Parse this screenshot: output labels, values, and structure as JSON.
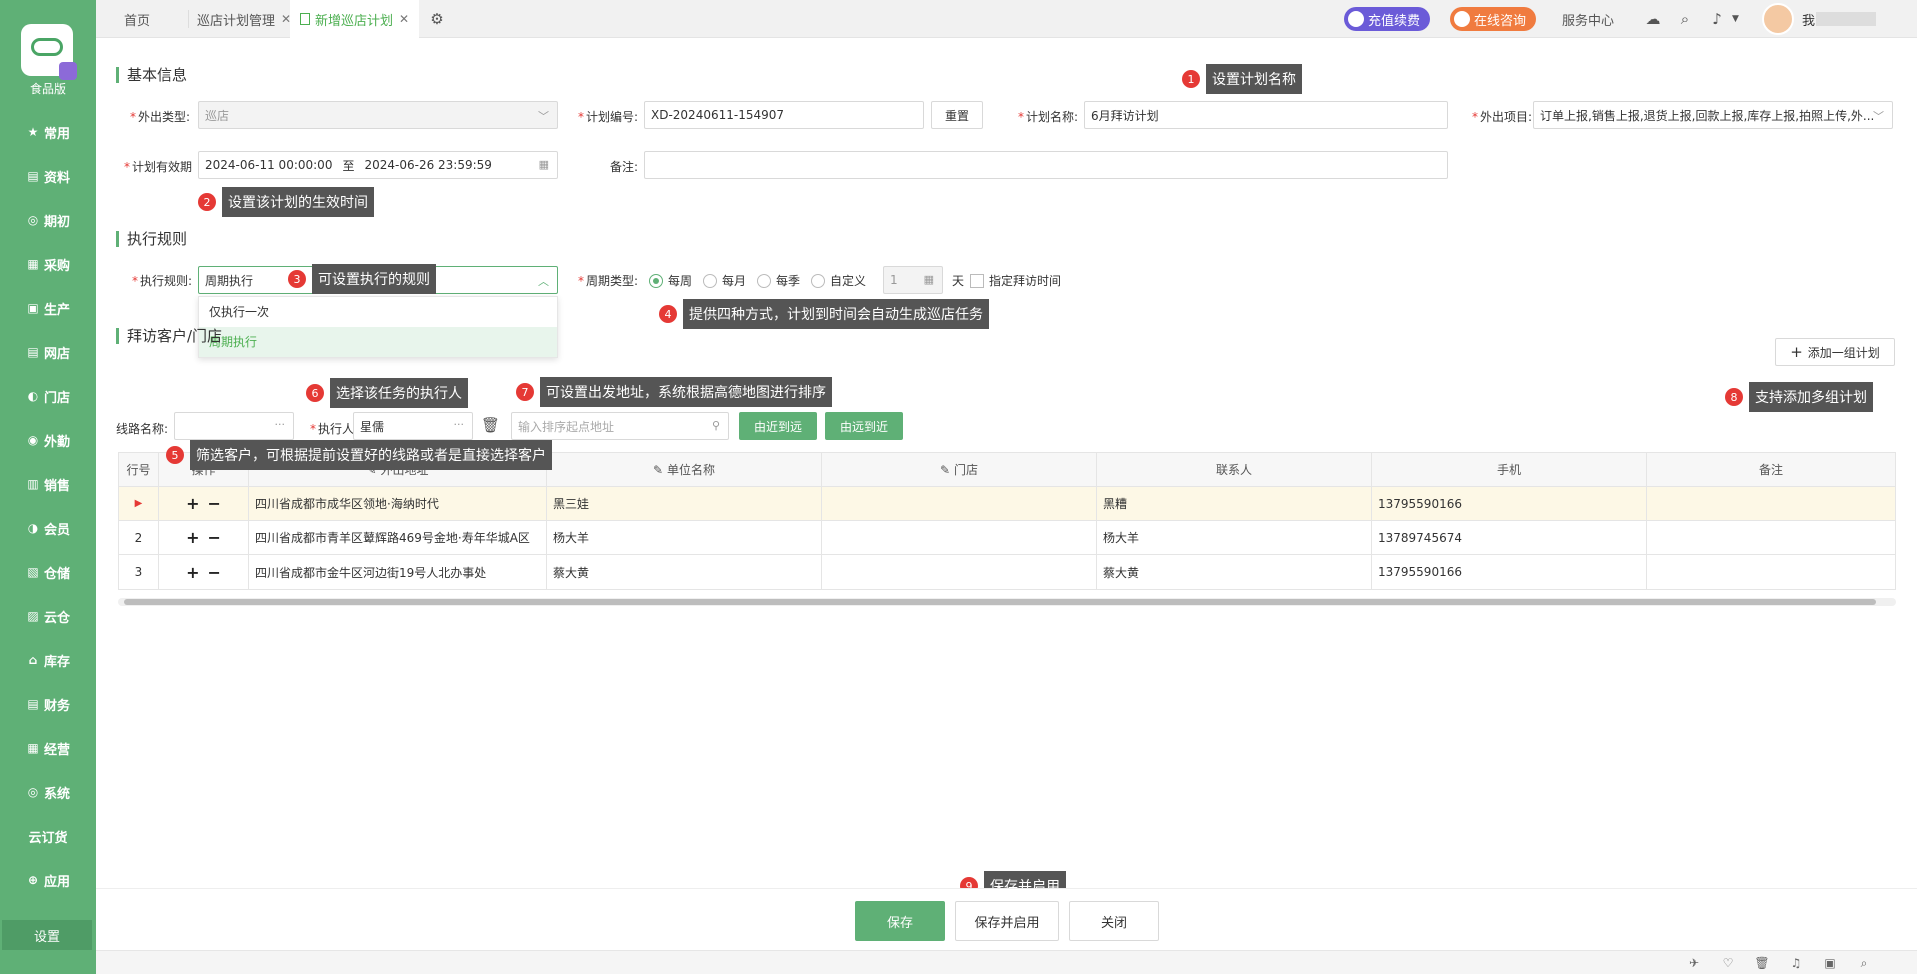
{
  "sidebar": {
    "logo_name": "食品版",
    "items": [
      {
        "label": "常用",
        "icon": "★"
      },
      {
        "label": "资料",
        "icon": "▤"
      },
      {
        "label": "期初",
        "icon": "◎"
      },
      {
        "label": "采购",
        "icon": "▦"
      },
      {
        "label": "生产",
        "icon": "▣"
      },
      {
        "label": "网店",
        "icon": "▤"
      },
      {
        "label": "门店",
        "icon": "◐"
      },
      {
        "label": "外勤",
        "icon": "◉"
      },
      {
        "label": "销售",
        "icon": "▥"
      },
      {
        "label": "会员",
        "icon": "◑"
      },
      {
        "label": "仓储",
        "icon": "▧"
      },
      {
        "label": "云仓",
        "icon": "▨"
      },
      {
        "label": "库存",
        "icon": "⌂"
      },
      {
        "label": "财务",
        "icon": "▤"
      },
      {
        "label": "经营",
        "icon": "▦"
      },
      {
        "label": "系统",
        "icon": "◎"
      },
      {
        "label": "云订货",
        "icon": ""
      },
      {
        "label": "应用",
        "icon": "⊕"
      }
    ],
    "settings": "设置"
  },
  "tabs": [
    {
      "label": "首页"
    },
    {
      "label": "巡店计划管理",
      "close": "✕"
    },
    {
      "label": "新增巡店计划",
      "close": "✕"
    }
  ],
  "topbar": {
    "recharge": "充值续费",
    "consult": "在线咨询",
    "service": "服务中心",
    "user_initial": "我"
  },
  "sections": {
    "basic": "基本信息",
    "rules": "执行规则",
    "visit": "拜访客户/门店"
  },
  "form": {
    "out_type_label": "外出类型:",
    "out_type_value": "巡店",
    "plan_no_label": "计划编号:",
    "plan_no_value": "XD-20240611-154907",
    "reset_btn": "重置",
    "plan_name_label": "计划名称:",
    "plan_name_value": "6月拜访计划",
    "out_items_label": "外出项目:",
    "out_items_value": "订单上报,销售上报,退货上报,回款上报,库存上报,拍照上传,外...",
    "valid_label": "计划有效期",
    "valid_start": "2024-06-11 00:00:00",
    "valid_sep": "至",
    "valid_end": "2024-06-26 23:59:59",
    "remark_label": "备注:",
    "rule_label": "执行规则:",
    "rule_value": "周期执行",
    "rule_options": [
      "仅执行一次",
      "周期执行"
    ],
    "cycle_label": "周期类型:",
    "cycle_options": [
      "每周",
      "每月",
      "每季",
      "自定义"
    ],
    "cycle_num": "1",
    "cycle_unit": "天",
    "specify_time": "指定拜访时间",
    "add_group_btn": "添加一组计划",
    "route_label": "线路名称:",
    "executor_label": "执行人:",
    "executor_value": "星儒",
    "start_addr_placeholder": "输入排序起点地址",
    "sort_near": "由近到远",
    "sort_far": "由远到近"
  },
  "table": {
    "headers": [
      "行号",
      "操作",
      "外出地址",
      "单位名称",
      "门店",
      "联系人",
      "手机",
      "备注"
    ],
    "rows": [
      {
        "no": "▶",
        "addr": "四川省成都市成华区领地·海纳时代",
        "unit": "黑三娃",
        "store": "",
        "contact": "黑糟",
        "phone": "13795590166",
        "remark": ""
      },
      {
        "no": "2",
        "addr": "四川省成都市青羊区鼙辉路469号金地·寿年华城A区",
        "unit": "杨大羊",
        "store": "",
        "contact": "杨大羊",
        "phone": "13789745674",
        "remark": ""
      },
      {
        "no": "3",
        "addr": "四川省成都市金牛区河边街19号人北办事处",
        "unit": "蔡大黄",
        "store": "",
        "contact": "蔡大黄",
        "phone": "13795590166",
        "remark": ""
      }
    ]
  },
  "callouts": [
    {
      "num": "1",
      "text": "设置计划名称"
    },
    {
      "num": "2",
      "text": "设置该计划的生效时间"
    },
    {
      "num": "3",
      "text": "可设置执行的规则"
    },
    {
      "num": "4",
      "text": "提供四种方式，计划到时间会自动生成巡店任务"
    },
    {
      "num": "5",
      "text": "筛选客户，可根据提前设置好的线路或者是直接选择客户"
    },
    {
      "num": "6",
      "text": "选择该任务的执行人"
    },
    {
      "num": "7",
      "text": "可设置出发地址，系统根据高德地图进行排序"
    },
    {
      "num": "8",
      "text": "支持添加多组计划"
    },
    {
      "num": "9",
      "text": "保存并启用"
    }
  ],
  "footer": {
    "save": "保存",
    "save_enable": "保存并启用",
    "close": "关闭"
  },
  "colors": {
    "brand": "#5fb076",
    "recharge": "#6b5bd8",
    "consult": "#f07b3f",
    "callout_num": "#e53935"
  }
}
